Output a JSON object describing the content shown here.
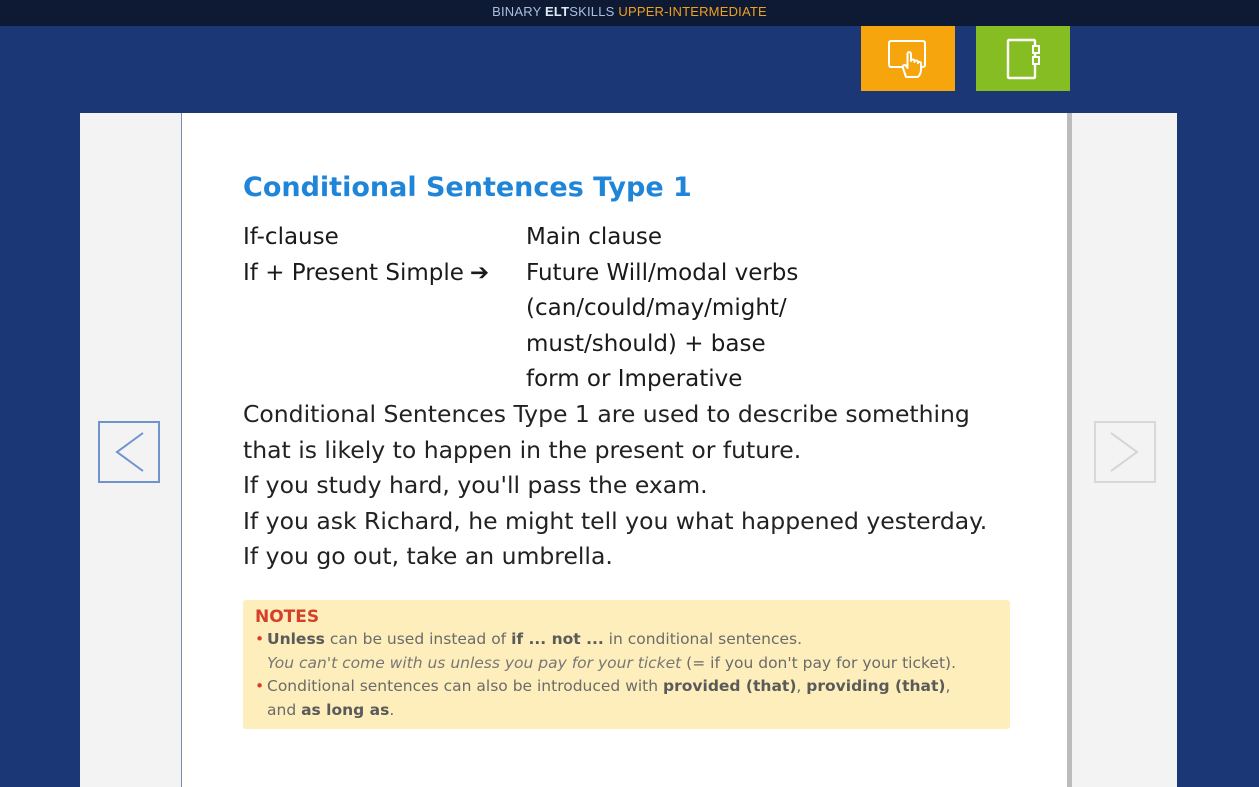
{
  "header": {
    "brand_binary": "BINARY",
    "brand_elt": "ELT",
    "brand_skills": "SKILLS",
    "brand_level": "UPPER-INTERMEDIATE"
  },
  "toolbar": {
    "touch_icon": "hand-pointer-icon",
    "notebook_icon": "notebook-icon",
    "touch_color": "#f6a50d",
    "notebook_color": "#86bd22"
  },
  "lesson": {
    "title": "Conditional Sentences Type 1",
    "if_clause_head": "If-clause",
    "if_clause_formula": "If + Present Simple",
    "arrow": "➔",
    "main_clause_head": "Main clause",
    "main_clause_lines": [
      "Future Will/modal verbs",
      "(can/could/may/might/",
      "must/should) + base",
      "form or Imperative"
    ],
    "body_lines": [
      "Conditional Sentences Type 1 are used to describe something",
      "that is likely to happen in the present or future.",
      "If you study hard, you'll pass the exam.",
      "If you ask Richard, he might tell you what happened yesterday.",
      "If you go out, take an umbrella."
    ]
  },
  "notes": {
    "title": "NOTES",
    "note1_bold": "Unless",
    "note1_mid": " can be used instead of ",
    "note1_bold2": "if ... not ...",
    "note1_end": " in conditional sentences.",
    "note1_example": "You can't come with us unless you pay for your ticket",
    "note1_gloss": " (= if you don't pay for your ticket).",
    "note2_start": "Conditional sentences can also be introduced with ",
    "note2_b1": "provided (that)",
    "note2_sep": ", ",
    "note2_b2": "providing (that)",
    "note2_comma": ",",
    "note2_and": "and ",
    "note2_b3": "as long as",
    "note2_end": "."
  },
  "navigation": {
    "prev_icon": "chevron-left-icon",
    "next_icon": "chevron-right-icon"
  }
}
